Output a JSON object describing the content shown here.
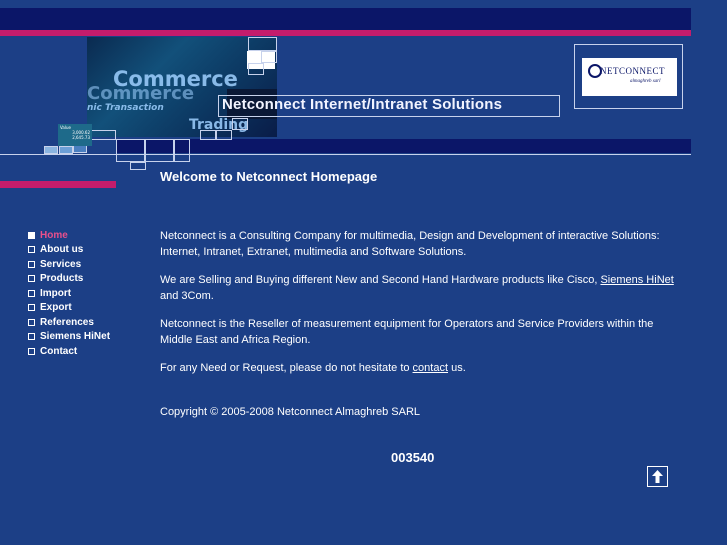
{
  "banner": {
    "headline": "Netconnect  Internet/Intranet Solutions",
    "collage_words": [
      "Commerce",
      "Commerce",
      "nic Transaction",
      "Trading"
    ],
    "ticker_label": "Value",
    "ticker_values": [
      "3,000.62",
      "2,645.73"
    ]
  },
  "logo": {
    "name": "NETCONNECT",
    "tagline": "almaghreb sarl"
  },
  "welcome": "Welcome to Netconnect  Homepage",
  "nav": [
    {
      "label": "Home",
      "active": true
    },
    {
      "label": "About us"
    },
    {
      "label": "Services"
    },
    {
      "label": "Products"
    },
    {
      "label": "Import"
    },
    {
      "label": "Export"
    },
    {
      "label": "References"
    },
    {
      "label": "Siemens HiNet"
    },
    {
      "label": "Contact"
    }
  ],
  "content": {
    "p1": "Netconnect is a Consulting Company for multimedia, Design and Development of interactive Solutions: Internet, Intranet, Extranet, multimedia and Software Solutions.",
    "p2_before": "We are Selling and Buying different New and Second Hand Hardware products like Cisco, ",
    "p2_link": "Siemens HiNet ",
    "p2_after": "and 3Com.",
    "p3": "Netconnect is the Reseller of measurement equipment for Operators and Service Providers within the Middle East and Africa Region.",
    "p4_before": "For any Need or Request, please do not hesitate to ",
    "p4_link": "contact",
    "p4_after": " us."
  },
  "copyright": "Copyright © 2005-2008 Netconnect Almaghreb SARL",
  "counter": "003540",
  "icons": {
    "scroll_top": "up-arrow-icon",
    "logo_mark": "globe-logo-icon"
  },
  "colors": {
    "background": "#1c3f86",
    "dark_bar": "#0b1668",
    "accent_pink": "#c41c6c",
    "active_nav": "#e8508c"
  }
}
